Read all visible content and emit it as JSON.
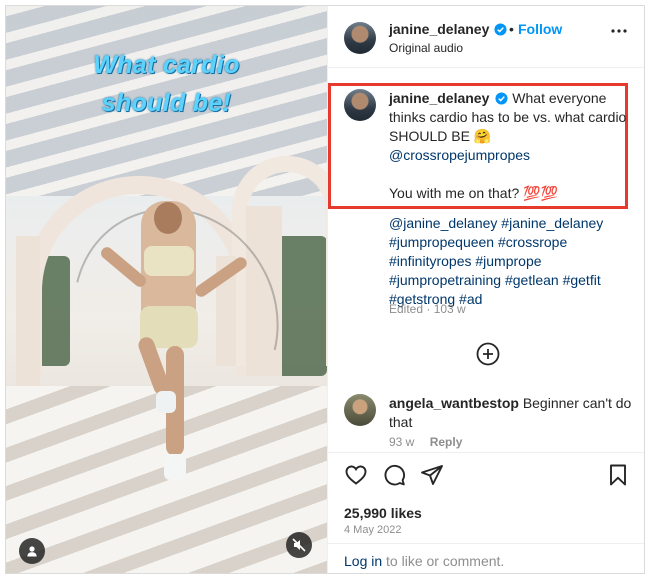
{
  "media": {
    "overlay_line1": "What cardio",
    "overlay_line2": "should be!",
    "user_icon": "user-icon",
    "mute_icon": "muted-speaker-icon"
  },
  "header": {
    "username": "janine_delaney",
    "separator": "•",
    "follow_label": "Follow",
    "subtitle": "Original audio",
    "more_icon": "more-options-icon"
  },
  "caption": {
    "username": "janine_delaney",
    "text": "What everyone thinks cardio has to be vs. what cardio SHOULD BE 🤗",
    "mention": "@crossropejumpropes",
    "question": "You with me on that? 💯💯",
    "highlight_color": "#e63a2e"
  },
  "hashtags": {
    "line1": "@janine_delaney #janine_delaney",
    "line2": "#jumpropequeen #crossrope",
    "line3": "#infinityropes #jumprope",
    "line4": "#jumpropetraining #getlean #getfit",
    "line5": "#getstrong #ad"
  },
  "edited": "Edited · 103 w",
  "comment": {
    "username": "angela_wantbestop",
    "text": "Beginner can't do that",
    "age": "93 w",
    "reply_label": "Reply"
  },
  "actions": {
    "likes": "25,990 likes",
    "date": "4 May 2022",
    "login_link": "Log in",
    "login_rest": " to like or comment."
  },
  "colors": {
    "link": "#0095f6",
    "hashtag": "#00376b",
    "meta": "#8e8e8e",
    "verified": "#0095f6"
  }
}
